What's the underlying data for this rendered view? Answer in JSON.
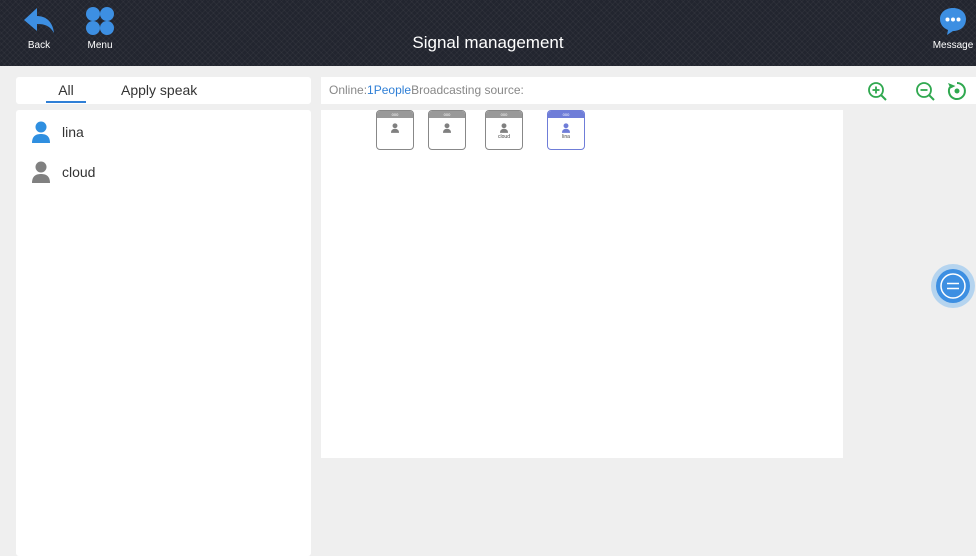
{
  "header": {
    "title": "Signal management",
    "back_label": "Back",
    "menu_label": "Menu",
    "message_label": "Message"
  },
  "tabs": [
    {
      "label": "All",
      "active": true
    },
    {
      "label": "Apply speak",
      "active": false
    }
  ],
  "users": [
    {
      "name": "lina",
      "icon": "person-icon",
      "color": "#2f8fe0"
    },
    {
      "name": "cloud",
      "icon": "person-icon",
      "color": "#808080"
    }
  ],
  "info": {
    "online_prefix": "Online:",
    "online_count": "1",
    "online_unit": "People",
    "broadcasting_label": "Broadcasting source:"
  },
  "zoom_controls": [
    "zoom-in-icon",
    "zoom-out-icon",
    "reset-icon"
  ],
  "seats": [
    {
      "header": "000",
      "name": "",
      "active": false
    },
    {
      "header": "000",
      "name": "",
      "active": false
    },
    {
      "header": "000",
      "name": "cloud",
      "active": false
    },
    {
      "header": "000",
      "name": "lina",
      "active": true
    }
  ],
  "colors": {
    "accent_blue": "#2f7fd6",
    "zoom_green": "#2fa84f",
    "seat_active": "#6f7dd8"
  }
}
